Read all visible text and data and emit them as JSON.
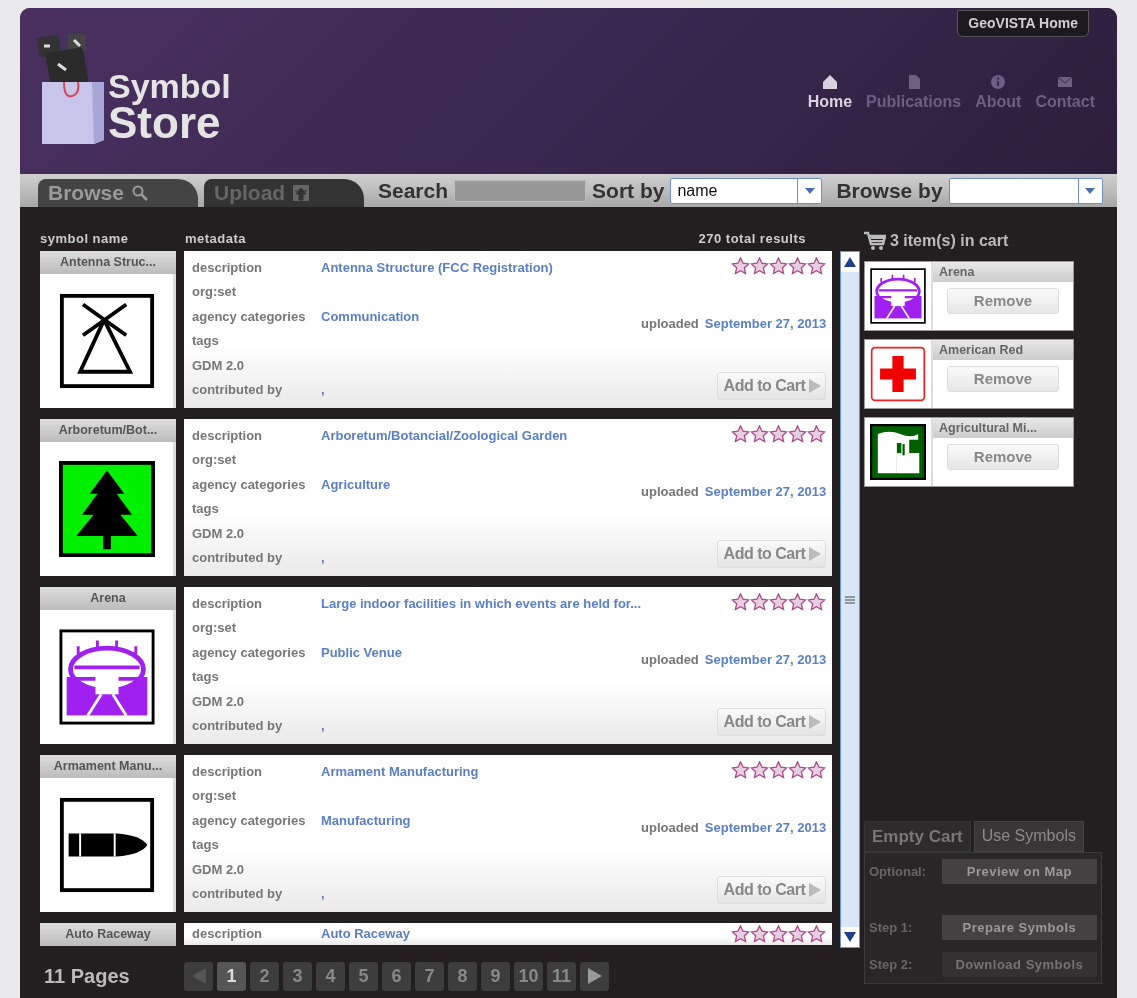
{
  "header": {
    "logo": {
      "line1": "Symbol",
      "line2": "Store"
    },
    "home_link": "GeoVISTA Home",
    "nav": [
      {
        "label": "Home",
        "selected": true
      },
      {
        "label": "Publications",
        "selected": false
      },
      {
        "label": "About",
        "selected": false
      },
      {
        "label": "Contact",
        "selected": false
      }
    ]
  },
  "toolbar": {
    "tabs": [
      {
        "label": "Browse",
        "selected": true
      },
      {
        "label": "Upload",
        "selected": false
      }
    ],
    "search_label": "Search",
    "sort_label": "Sort by",
    "sort_value": "name",
    "browse_label": "Browse by"
  },
  "results": {
    "columns": [
      "symbol name",
      "metadata"
    ],
    "total": "270 total results",
    "items": [
      {
        "name": "Antenna Struc...",
        "kind": "antenna",
        "stars": 0,
        "fields": [
          {
            "label": "description",
            "value": "Antenna Structure (FCC Registration)"
          },
          {
            "label": "org:set"
          },
          {
            "label": "agency categories",
            "value": "Communication"
          },
          {
            "label": "tags"
          },
          {
            "label": "GDM 2.0"
          },
          {
            "label": "contributed by",
            "value": ","
          }
        ],
        "uploaded_label": "uploaded",
        "uploaded": "September 27, 2013",
        "button": "Add to Cart"
      },
      {
        "name": "Arboretum/Bot...",
        "kind": "tree",
        "stars": 0,
        "fields": [
          {
            "label": "description",
            "value": "Arboretum/Botancial/Zoological Garden"
          },
          {
            "label": "org:set"
          },
          {
            "label": "agency categories",
            "value": "Agriculture"
          },
          {
            "label": "tags"
          },
          {
            "label": "GDM 2.0"
          },
          {
            "label": "contributed by",
            "value": ","
          }
        ],
        "uploaded_label": "uploaded",
        "uploaded": "September 27, 2013",
        "button": "Add to Cart"
      },
      {
        "name": "Arena",
        "kind": "arena",
        "stars": 0,
        "fields": [
          {
            "label": "description",
            "value": "Large indoor facilities in which events are held for..."
          },
          {
            "label": "org:set"
          },
          {
            "label": "agency categories",
            "value": "Public Venue"
          },
          {
            "label": "tags"
          },
          {
            "label": "GDM 2.0"
          },
          {
            "label": "contributed by",
            "value": ","
          }
        ],
        "uploaded_label": "uploaded",
        "uploaded": "September 27, 2013",
        "button": "Add to Cart"
      },
      {
        "name": "Armament Manu...",
        "kind": "bullet",
        "stars": 0,
        "fields": [
          {
            "label": "description",
            "value": "Armament Manufacturing"
          },
          {
            "label": "org:set"
          },
          {
            "label": "agency categories",
            "value": "Manufacturing"
          },
          {
            "label": "tags"
          },
          {
            "label": "GDM 2.0"
          },
          {
            "label": "contributed by",
            "value": ","
          }
        ],
        "uploaded_label": "uploaded",
        "uploaded": "September 27, 2013",
        "button": "Add to Cart"
      },
      {
        "name": "Auto Raceway",
        "stars": 0,
        "fields": [
          {
            "label": "description",
            "value": "Auto Raceway"
          }
        ]
      }
    ]
  },
  "pagination": {
    "label": "11 Pages",
    "prev_disabled": true,
    "pages": [
      {
        "label": "1",
        "selected": true
      },
      {
        "label": "2",
        "selected": false
      },
      {
        "label": "3",
        "selected": false
      },
      {
        "label": "4",
        "selected": false
      },
      {
        "label": "5",
        "selected": false
      },
      {
        "label": "6",
        "selected": false
      },
      {
        "label": "7",
        "selected": false
      },
      {
        "label": "8",
        "selected": false
      },
      {
        "label": "9",
        "selected": false
      },
      {
        "label": "10",
        "selected": false
      },
      {
        "label": "11",
        "selected": false
      }
    ]
  },
  "cart": {
    "count_text": "3 item(s) in cart",
    "items": [
      {
        "name": "Arena",
        "kind": "arena",
        "button": "Remove"
      },
      {
        "name": "American Red",
        "kind": "redcross",
        "button": "Remove"
      },
      {
        "name": "Agricultural Mi...",
        "kind": "factory",
        "button": "Remove"
      }
    ],
    "tabs": [
      {
        "label": "Empty Cart",
        "selected": false
      },
      {
        "label": "Use Symbols",
        "selected": true
      }
    ],
    "steps": [
      {
        "label": "Optional:",
        "button": "Preview on Map",
        "disabled": false
      },
      {
        "label": "Step 1:",
        "button": "Prepare Symbols",
        "disabled": false
      },
      {
        "label": "Step 2:",
        "button": "Download Symbols",
        "disabled": true
      }
    ]
  }
}
